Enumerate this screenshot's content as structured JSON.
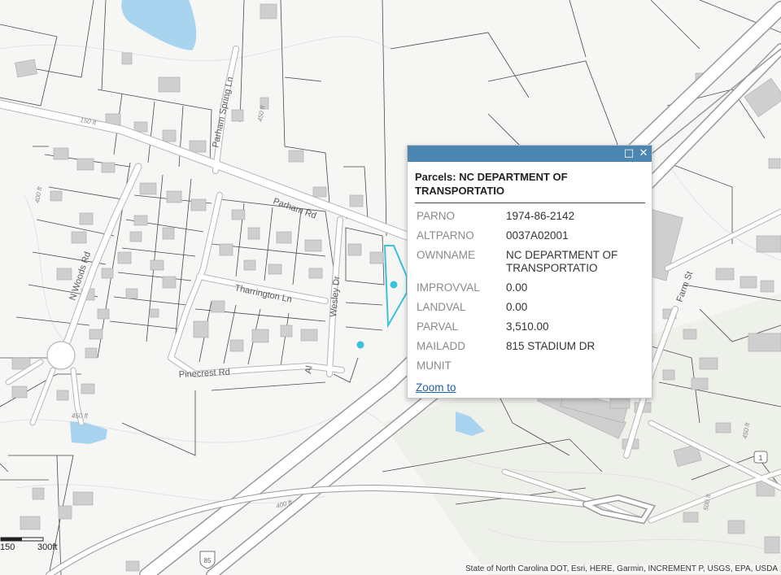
{
  "map": {
    "road_labels": {
      "parham_rd": "Parham Rd",
      "parham_spring_ln": "Parham Spring Ln",
      "n_woods_rd": "N Woods Rd",
      "tharrington_ln": "Tharrington Ln",
      "wesley_dr": "Wesley Dr",
      "pinecrest_rd": "Pinecrest Rd",
      "farm_st": "Farm St",
      "unnamed": "Al"
    },
    "elevation_labels": [
      "150 ft",
      "450 ft",
      "400 ft",
      "450 ft",
      "400 ft",
      "500 ft",
      "450 ft"
    ],
    "shield_labels": {
      "interstate": "85",
      "us_route": "1"
    },
    "colors": {
      "water": "#a8d4ef",
      "highlight": "#3ac1dc",
      "road_fill": "#ffffff",
      "road_casing": "#b8b8b8",
      "building": "#cfcfcf"
    }
  },
  "popup": {
    "title": "Parcels: NC DEPARTMENT OF TRANSPORTATIO",
    "maximize_icon": "maximize-icon",
    "close_icon": "close-icon",
    "attributes": [
      {
        "key": "PARNO",
        "value": "1974-86-2142"
      },
      {
        "key": "ALTPARNO",
        "value": "0037A02001"
      },
      {
        "key": "OWNNAME",
        "value": "NC DEPARTMENT OF TRANSPORTATIO"
      },
      {
        "key": "IMPROVVAL",
        "value": "0.00"
      },
      {
        "key": "LANDVAL",
        "value": "0.00"
      },
      {
        "key": "PARVAL",
        "value": "3,510.00"
      },
      {
        "key": "MAILADD",
        "value": "815 STADIUM DR"
      },
      {
        "key": "MUNIT",
        "value": ""
      }
    ],
    "zoom_link": "Zoom to"
  },
  "scale": {
    "left_label": "150",
    "right_label": "300ft"
  },
  "attribution": "State of North Carolina DOT, Esri, HERE, Garmin, INCREMENT P, USGS, EPA, USDA"
}
